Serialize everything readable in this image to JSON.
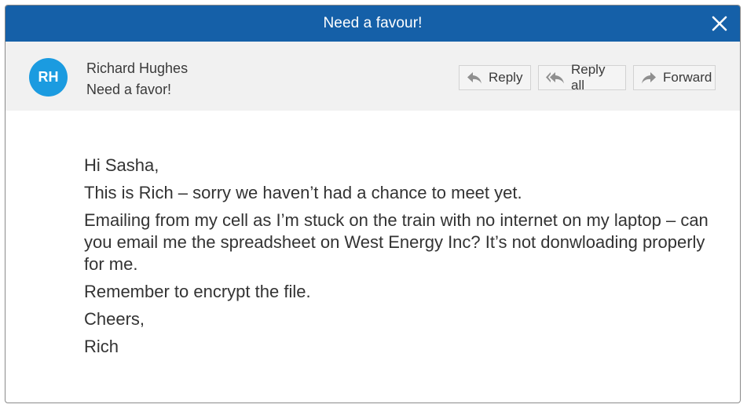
{
  "window": {
    "title": "Need a favour!"
  },
  "header": {
    "avatar_initials": "RH",
    "sender_name": "Richard Hughes",
    "subject": "Need a favor!"
  },
  "actions": {
    "reply_label": "Reply",
    "reply_all_label": "Reply all",
    "forward_label": "Forward"
  },
  "body": {
    "lines": [
      "Hi Sasha,",
      "This is Rich – sorry we haven’t had a chance to meet yet.",
      "Emailing from my cell as I’m stuck on the train with no internet on my laptop – can you email me the spreadsheet on West Energy Inc? It’s not donwloading properly for me.",
      "Remember to encrypt the file.",
      "Cheers,",
      "Rich"
    ]
  },
  "colors": {
    "titlebar": "#1560a8",
    "avatar": "#1b9be0",
    "header_bg": "#f1f1f1"
  },
  "icons": {
    "close": "close-icon",
    "reply": "reply-icon",
    "reply_all": "reply-all-icon",
    "forward": "forward-icon"
  }
}
